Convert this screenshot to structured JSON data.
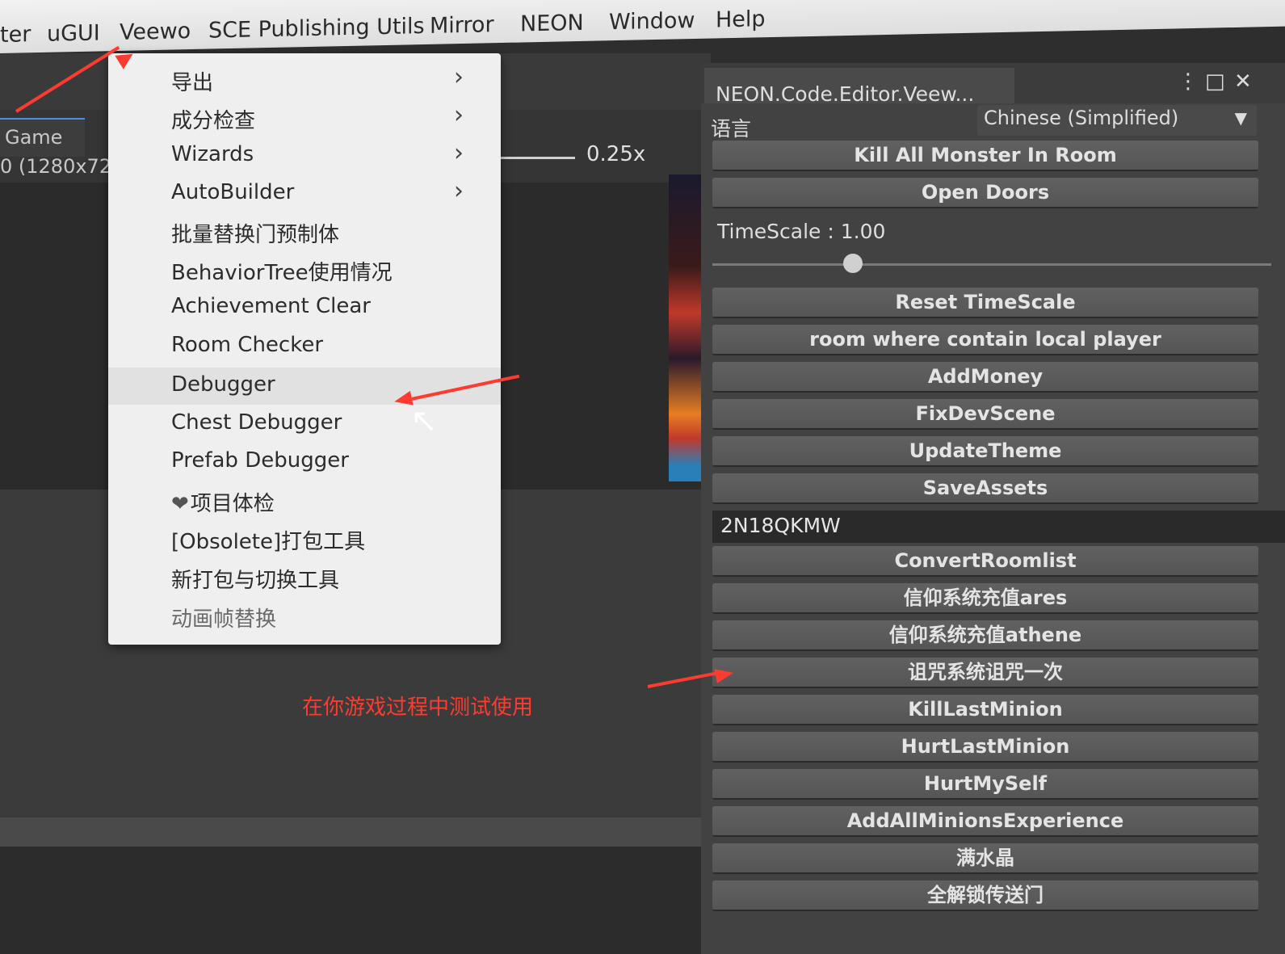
{
  "menubar": {
    "items": [
      "ter",
      "uGUI",
      "Veewo",
      "SCE Publishing Utils",
      "Mirror",
      "NEON",
      "Window",
      "Help"
    ]
  },
  "game_view": {
    "tab_label": "Game",
    "resolution": "0 (1280x72",
    "scale": "0.25x"
  },
  "veewo_menu": {
    "items": [
      {
        "label": "导出",
        "submenu": true
      },
      {
        "label": "成分检查",
        "submenu": true
      },
      {
        "label": "Wizards",
        "submenu": true
      },
      {
        "label": "AutoBuilder",
        "submenu": true
      },
      {
        "label": "批量替换门预制体",
        "submenu": false
      },
      {
        "label": "BehaviorTree使用情况",
        "submenu": false
      },
      {
        "label": "Achievement Clear",
        "submenu": false
      },
      {
        "label": "Room Checker",
        "submenu": false
      },
      {
        "label": "Debugger",
        "submenu": false,
        "highlighted": true
      },
      {
        "label": "Chest Debugger",
        "submenu": false
      },
      {
        "label": "Prefab Debugger",
        "submenu": false
      },
      {
        "label": "项目体检",
        "submenu": false,
        "icon": "heart-icon"
      },
      {
        "label": "[Obsolete]打包工具",
        "submenu": false
      },
      {
        "label": "新打包与切换工具",
        "submenu": false
      },
      {
        "label": "动画帧替换",
        "submenu": false
      }
    ],
    "submenu_arrow": "›",
    "heart_glyph": "❤"
  },
  "debug_panel": {
    "title": "NEON.Code.Editor.Veew...",
    "icons": {
      "kebab": "⋮",
      "maximize": "□",
      "close": "✕"
    },
    "language_label": "语言",
    "language_value": "Chinese (Simplified)",
    "language_caret": "▼",
    "buttons_top": [
      "Kill All Monster In Room",
      "Open Doors"
    ],
    "timescale_label": "TimeScale : 1.00",
    "timescale_value": 1.0,
    "buttons_mid": [
      "Reset TimeScale",
      "room where contain local player",
      "AddMoney",
      "FixDevScene",
      "UpdateTheme",
      "SaveAssets"
    ],
    "section_label": "2N18QKMW",
    "buttons_bottom": [
      "ConvertRoomlist",
      "信仰系统充值ares",
      "信仰系统充值athene",
      "诅咒系统诅咒一次",
      "KillLastMinion",
      "HurtLastMinion",
      "HurtMySelf",
      "AddAllMinionsExperience",
      "满水晶",
      "全解锁传送门"
    ]
  },
  "annotation": "在你游戏过程中测试使用",
  "colors": {
    "annotation": "#ff3b30",
    "menu_bg": "#efefef",
    "panel_bg": "#424242"
  }
}
